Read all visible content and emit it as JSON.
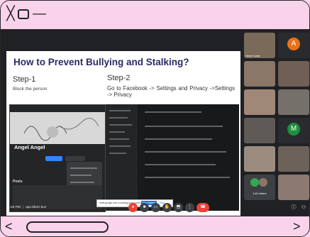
{
  "window": {
    "close_glyph": "╳",
    "minimize_glyph": "—"
  },
  "slide": {
    "title": "How to Prevent Bullying and Stalking?",
    "step1_title": "Step-1",
    "step1_text": "Block the person",
    "step2_title": "Step-2",
    "step2_text": "Go to Facebook -> Settings and Privacy ->Settings -> Privacy",
    "profile_name": "Angel Angel",
    "posts_label": "Posts"
  },
  "share_bar": {
    "text": "meet.google.com is sharing your screen.",
    "stop_label": "Stop sharing",
    "hide_label": "Hide"
  },
  "participants": [
    {
      "name": "Harsh Kumar",
      "color": "#7a6a5a"
    },
    {
      "name": "",
      "letter": "A",
      "color": "#e8711a"
    },
    {
      "name": "",
      "color": "#8a7767"
    },
    {
      "name": "",
      "color": "#6f5f55"
    },
    {
      "name": "",
      "color": "#a08878"
    },
    {
      "name": "",
      "color": "#75706a"
    },
    {
      "name": "",
      "color": "#5f5a55"
    },
    {
      "name": "",
      "letter": "M",
      "color": "#1e8e3e"
    },
    {
      "name": "",
      "color": "#9c8c80"
    },
    {
      "name": "",
      "color": "#6d625a"
    },
    {
      "name": "",
      "color": "#8c7a70"
    }
  ],
  "more_tile": {
    "label": "143 others"
  },
  "meeting": {
    "time": "4:26 PM",
    "code": "apx-kbmr-kuz"
  },
  "controls": {
    "mic_glyph": "●",
    "cam_glyph": "■",
    "cc_glyph": "▭",
    "hand_glyph": "✋",
    "present_glyph": "⬒",
    "more_glyph": "⋮",
    "end_glyph": "☎",
    "info_glyph": "ⓘ",
    "people_glyph": "⚇"
  },
  "scroll": {
    "left_glyph": "<",
    "right_glyph": ">"
  },
  "colors": {
    "chrome_pink": "#f9d3ec",
    "meet_bg": "#202124",
    "end_call_red": "#ea4335",
    "slide_title": "#2a2a66"
  }
}
